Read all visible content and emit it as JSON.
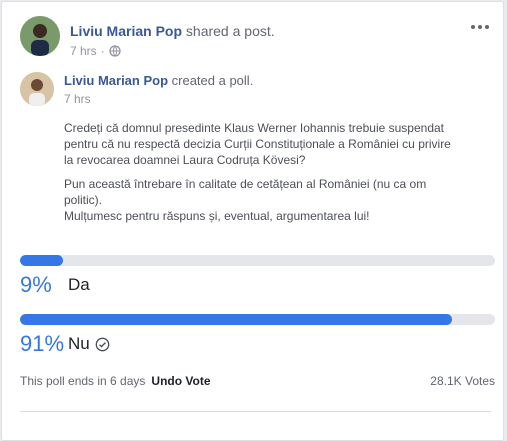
{
  "post": {
    "author": "Liviu Marian Pop",
    "action": "shared a post.",
    "time": "7 hrs",
    "privacy_icon": "globe-icon",
    "more_icon": "ellipsis-icon"
  },
  "shared": {
    "author": "Liviu Marian Pop",
    "action": "created a poll.",
    "time": "7 hrs",
    "question": "Credeți că domnul presedinte Klaus Werner Iohannis trebuie suspendat\npentru că nu respectă decizia Curții Constituționale a României cu privire\nla revocarea doamnei Laura Codruța Kövesi?",
    "note": "Pun această întrebare în calitate de cetățean al României (nu ca om\npolitic).\nMulțumesc pentru răspuns și, eventual, argumentarea lui!"
  },
  "poll": {
    "accent_color": "#3578e5",
    "options": [
      {
        "percent_label": "9%",
        "fraction": 0.09,
        "label": "Da",
        "selected": false
      },
      {
        "percent_label": "91%",
        "fraction": 0.91,
        "label": "Nu",
        "selected": true
      }
    ],
    "ends_text": "This poll ends in 6 days",
    "undo_label": "Undo Vote",
    "votes": "28.1K Votes"
  }
}
